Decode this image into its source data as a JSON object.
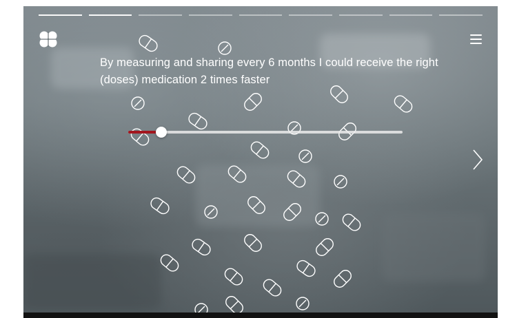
{
  "progress": {
    "segments": 9,
    "completed": 2
  },
  "logo": {
    "icon": "heart-logo-icon"
  },
  "menu": {
    "icon": "hamburger-menu-icon"
  },
  "headline": {
    "text": "By measuring and sharing every 6 months I could receive the right (doses) medication 2 times faster"
  },
  "slider": {
    "value": 0.12,
    "accent_color": "#a3161e",
    "track_color": "#ebebeb"
  },
  "navigation": {
    "next_icon": "chevron-right-icon"
  }
}
